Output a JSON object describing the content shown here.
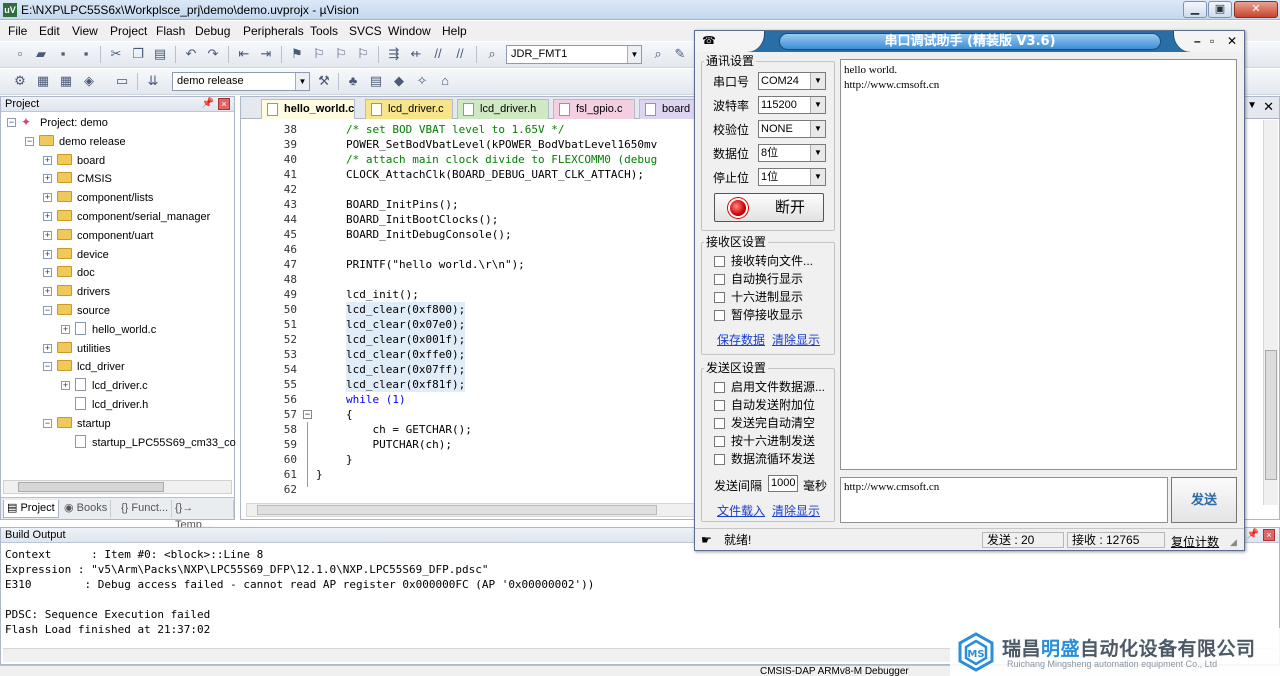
{
  "window": {
    "title": "E:\\NXP\\LPC55S6x\\Workplsce_prj\\demo\\demo.uvprojx - µVision",
    "app_icon": "uv-icon"
  },
  "menu": [
    "File",
    "Edit",
    "View",
    "Project",
    "Flash",
    "Debug",
    "Peripherals",
    "Tools",
    "SVCS",
    "Window",
    "Help"
  ],
  "toolbar": {
    "find_combo": "JDR_FMT1",
    "target_combo": "demo release"
  },
  "project_panel": {
    "title": "Project",
    "tree": [
      {
        "label": "Project: demo",
        "level": 0,
        "kind": "project",
        "exp": "minus"
      },
      {
        "label": "demo release",
        "level": 1,
        "kind": "target",
        "exp": "minus"
      },
      {
        "label": "board",
        "level": 2,
        "kind": "folder",
        "exp": "plus"
      },
      {
        "label": "CMSIS",
        "level": 2,
        "kind": "folder",
        "exp": "plus"
      },
      {
        "label": "component/lists",
        "level": 2,
        "kind": "folder",
        "exp": "plus"
      },
      {
        "label": "component/serial_manager",
        "level": 2,
        "kind": "folder",
        "exp": "plus"
      },
      {
        "label": "component/uart",
        "level": 2,
        "kind": "folder",
        "exp": "plus"
      },
      {
        "label": "device",
        "level": 2,
        "kind": "folder",
        "exp": "plus"
      },
      {
        "label": "doc",
        "level": 2,
        "kind": "folder",
        "exp": "plus"
      },
      {
        "label": "drivers",
        "level": 2,
        "kind": "folder",
        "exp": "plus"
      },
      {
        "label": "source",
        "level": 2,
        "kind": "folder",
        "exp": "minus"
      },
      {
        "label": "hello_world.c",
        "level": 3,
        "kind": "file",
        "exp": "plus"
      },
      {
        "label": "utilities",
        "level": 2,
        "kind": "folder",
        "exp": "plus"
      },
      {
        "label": "lcd_driver",
        "level": 2,
        "kind": "folder",
        "exp": "minus"
      },
      {
        "label": "lcd_driver.c",
        "level": 3,
        "kind": "file",
        "exp": "plus"
      },
      {
        "label": "lcd_driver.h",
        "level": 3,
        "kind": "file",
        "exp": "none"
      },
      {
        "label": "startup",
        "level": 2,
        "kind": "folder",
        "exp": "minus"
      },
      {
        "label": "startup_LPC55S69_cm33_co",
        "level": 3,
        "kind": "file",
        "exp": "none"
      }
    ],
    "tabs": [
      {
        "label": "Project",
        "active": true
      },
      {
        "label": "Books",
        "active": false
      },
      {
        "label": "{} Funct...",
        "active": false
      },
      {
        "label": "{}→ Temp...",
        "active": false
      }
    ]
  },
  "editor": {
    "tabs": [
      {
        "label": "hello_world.c",
        "style": "active"
      },
      {
        "label": "lcd_driver.c",
        "style": "yellow"
      },
      {
        "label": "lcd_driver.h",
        "style": "green"
      },
      {
        "label": "fsl_gpio.c",
        "style": "pink"
      },
      {
        "label": "board",
        "style": "violet"
      }
    ],
    "lines": [
      {
        "no": "38",
        "text": "/* set BOD VBAT level to 1.65V */",
        "cls": "c-cmt"
      },
      {
        "no": "39",
        "text": "POWER_SetBodVbatLevel(kPOWER_BodVbatLevel1650mv",
        "cls": ""
      },
      {
        "no": "40",
        "text": "/* attach main clock divide to FLEXCOMM0 (debug",
        "cls": "c-cmt"
      },
      {
        "no": "41",
        "text": "CLOCK_AttachClk(BOARD_DEBUG_UART_CLK_ATTACH);",
        "cls": ""
      },
      {
        "no": "42",
        "text": "",
        "cls": ""
      },
      {
        "no": "43",
        "text": "BOARD_InitPins();",
        "cls": ""
      },
      {
        "no": "44",
        "text": "BOARD_InitBootClocks();",
        "cls": ""
      },
      {
        "no": "45",
        "text": "BOARD_InitDebugConsole();",
        "cls": ""
      },
      {
        "no": "46",
        "text": "",
        "cls": ""
      },
      {
        "no": "47",
        "text": "PRINTF(\"hello world.\\r\\n\");",
        "cls": ""
      },
      {
        "no": "48",
        "text": "",
        "cls": ""
      },
      {
        "no": "49",
        "text": "lcd_init();",
        "cls": ""
      },
      {
        "no": "50",
        "text": "lcd_clear(0xf800);",
        "cls": "c-hl"
      },
      {
        "no": "51",
        "text": "lcd_clear(0x07e0);",
        "cls": "c-hl"
      },
      {
        "no": "52",
        "text": "lcd_clear(0x001f);",
        "cls": "c-hl"
      },
      {
        "no": "53",
        "text": "lcd_clear(0xffe0);",
        "cls": "c-hl"
      },
      {
        "no": "54",
        "text": "lcd_clear(0x07ff);",
        "cls": "c-hl"
      },
      {
        "no": "55",
        "text": "lcd_clear(0xf81f);",
        "cls": "c-hl"
      },
      {
        "no": "56",
        "text": "while (1)",
        "cls": "c-kw"
      },
      {
        "no": "57",
        "text": "{",
        "cls": ""
      },
      {
        "no": "58",
        "text": "    ch = GETCHAR();",
        "cls": ""
      },
      {
        "no": "59",
        "text": "    PUTCHAR(ch);",
        "cls": ""
      },
      {
        "no": "60",
        "text": "}",
        "cls": ""
      },
      {
        "no": "61",
        "text": "}",
        "cls": "outer"
      },
      {
        "no": "62",
        "text": "",
        "cls": ""
      }
    ]
  },
  "build_output": {
    "title": "Build Output",
    "lines": [
      "Context      : Item #0: <block>::Line 8",
      "Expression : \"v5\\Arm\\Packs\\NXP\\LPC55S69_DFP\\12.1.0\\NXP.LPC55S69_DFP.pdsc\"",
      "E310        : Debug access failed - cannot read AP register 0x000000FC (AP '0x00000002'))",
      "",
      "PDSC: Sequence Execution failed",
      "Flash Load finished at 21:37:02"
    ]
  },
  "statusbar": {
    "debugger": "CMSIS-DAP ARMv8-M Debugger"
  },
  "watermark": {
    "cn_a": "瑞昌",
    "cn_b": "明盛",
    "cn_c": "自动化设备有限公司",
    "en": "Ruichang Mingsheng automation equipment Co., Ltd"
  },
  "serial_tool": {
    "title": "串口调试助手 (精装版 V3.6)",
    "comm_group": "通讯设置",
    "port_label": "串口号",
    "port_value": "COM24",
    "baud_label": "波特率",
    "baud_value": "115200",
    "parity_label": "校验位",
    "parity_value": "NONE",
    "data_label": "数据位",
    "data_value": "8位",
    "stop_label": "停止位",
    "stop_value": "1位",
    "disconnect": "断开",
    "recv_group": "接收区设置",
    "recv_options": [
      "接收转向文件...",
      "自动换行显示",
      "十六进制显示",
      "暂停接收显示"
    ],
    "save_data": "保存数据",
    "clear_display": "清除显示",
    "send_group": "发送区设置",
    "send_options": [
      "启用文件数据源...",
      "自动发送附加位",
      "发送完自动清空",
      "按十六进制发送",
      "数据流循环发送"
    ],
    "interval_label": "发送间隔",
    "interval_value": "1000",
    "interval_unit": "毫秒",
    "load_file": "文件载入",
    "clear_send": "清除显示",
    "recv_lines": [
      "hello world.",
      "http://www.cmsoft.cn"
    ],
    "send_text": "http://www.cmsoft.cn",
    "send_button": "发送",
    "status_ready": "就绪!",
    "sent": "发送 : 20",
    "received": "接收 : 12765",
    "reset_count": "复位计数"
  }
}
